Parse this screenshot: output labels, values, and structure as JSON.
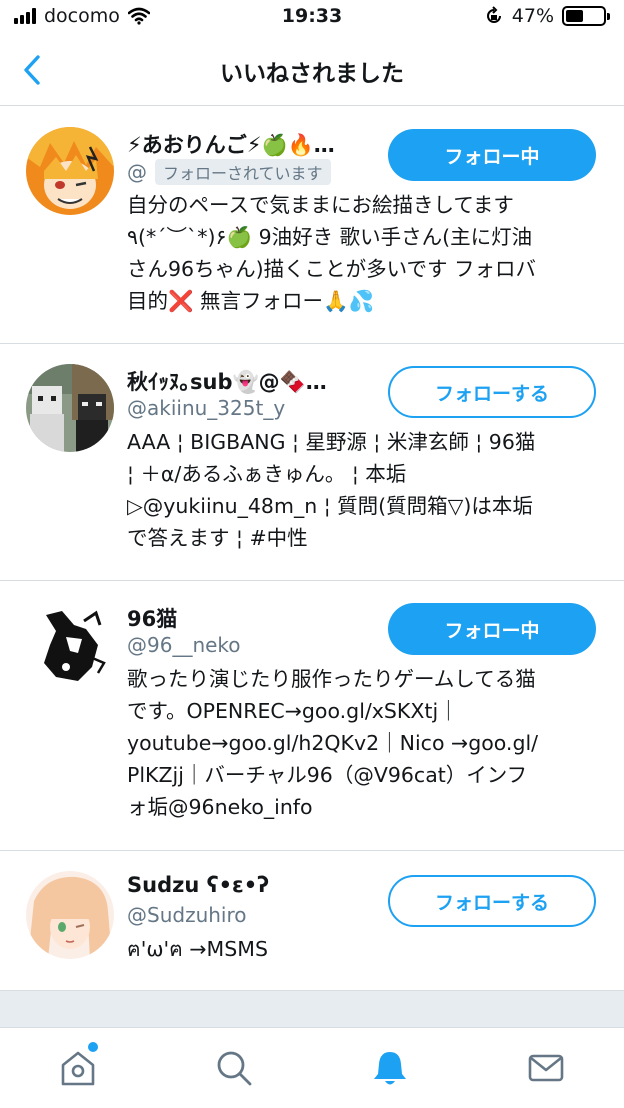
{
  "status": {
    "carrier": "docomo",
    "time": "19:33",
    "battery": "47%",
    "battery_level": 0.47
  },
  "nav": {
    "title": "いいねされました"
  },
  "users": [
    {
      "name": "⚡あおりんご⚡🍏🔥…",
      "handle": "@",
      "badge": "フォローされています",
      "bio": [
        "自分のペースで気ままにお絵描きしてます",
        "٩(*´︶`*)۶🍏 9油好き 歌い手さん(主に灯油",
        "さん96ちゃん)描くことが多いです フォロバ",
        "目的❌ 無言フォロー🙏💦"
      ],
      "button": "フォロー中"
    },
    {
      "name": "秋ｲｯﾇ｡sub👻@🍫…",
      "handle": "@akiinu_325t_y",
      "bio": [
        "AAA ¦ BIGBANG ¦ 星野源 ¦ 米津玄師 ¦ 96猫",
        "¦ ＋α/あるふぁきゅん。 ¦ 本垢",
        "▷@yukiinu_48m_n ¦ 質問(質問箱▽)は本垢",
        "で答えます ¦ #中性"
      ],
      "button": "フォローする"
    },
    {
      "name": "96猫",
      "handle": "@96__neko",
      "bio": [
        "歌ったり演じたり服作ったりゲームしてる猫",
        "です。OPENREC→goo.gl/xSKXtj｜",
        "youtube→goo.gl/h2QKv2｜Nico →goo.gl/",
        "PlKZjj｜バーチャル96（@V96cat）インフ",
        "ォ垢@96neko_info"
      ],
      "button": "フォロー中"
    },
    {
      "name": "Sudzu ʕ•ε•ʔ",
      "handle": "@Sudzuhiro",
      "bio": [
        "ฅ'ω'ฅ →MSMS"
      ],
      "button": "フォローする"
    }
  ],
  "tabs": [
    {
      "name": "home",
      "icon": "home-icon",
      "has_dot": true
    },
    {
      "name": "search",
      "icon": "search-icon"
    },
    {
      "name": "notifications",
      "icon": "bell-icon",
      "active": true
    },
    {
      "name": "messages",
      "icon": "mail-icon"
    }
  ],
  "colors": {
    "accent": "#1da1f2",
    "divider": "#d8dde1",
    "muted": "#657786"
  }
}
